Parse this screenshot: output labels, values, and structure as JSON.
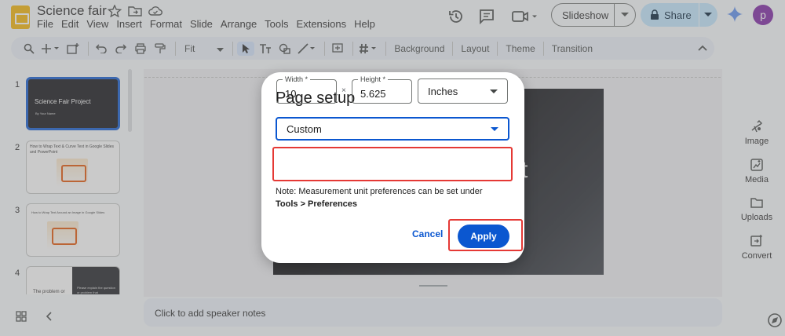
{
  "app": {
    "title": "Science fair"
  },
  "menu": [
    "File",
    "Edit",
    "View",
    "Insert",
    "Format",
    "Slide",
    "Arrange",
    "Tools",
    "Extensions",
    "Help"
  ],
  "header": {
    "slideshow_label": "Slideshow",
    "share_label": "Share",
    "avatar_initial": "p"
  },
  "toolbar": {
    "zoom_value": "Fit",
    "background_label": "Background",
    "layout_label": "Layout",
    "theme_label": "Theme",
    "transition_label": "Transition"
  },
  "filmstrip": {
    "slides": [
      {
        "number": "1",
        "title": "Science Fair Project",
        "subtitle": "By Your Name"
      },
      {
        "number": "2",
        "title": "How to Wrap Text & Curve Text in Google Slides and PowerPoint"
      },
      {
        "number": "3",
        "title": "How to Wrap Text Around an Image in Google Slides"
      },
      {
        "number": "4",
        "title": "The problem or",
        "side_text": "Please explain the question or problem that"
      }
    ]
  },
  "canvas": {
    "partial_text": "t"
  },
  "notes": {
    "placeholder": "Click to add speaker notes"
  },
  "side_panel": {
    "items": [
      {
        "label": "Image",
        "icon": "image-icon"
      },
      {
        "label": "Media",
        "icon": "media-icon"
      },
      {
        "label": "Uploads",
        "icon": "folder-icon"
      },
      {
        "label": "Convert",
        "icon": "convert-icon"
      }
    ]
  },
  "dialog": {
    "title": "Page setup",
    "preset_value": "Custom",
    "width_label": "Width *",
    "width_value": "10",
    "times_symbol": "×",
    "height_label": "Height *",
    "height_value": "5.625",
    "unit_value": "Inches",
    "note_text": "Note: Measurement unit preferences can be set under",
    "note_path": "Tools > Preferences",
    "cancel_label": "Cancel",
    "apply_label": "Apply"
  },
  "colors": {
    "accent": "#0b57d0",
    "share_bg": "#c2e7ff",
    "highlight": "#e53935",
    "avatar": "#7b1fa2",
    "logo": "#f4b400"
  }
}
